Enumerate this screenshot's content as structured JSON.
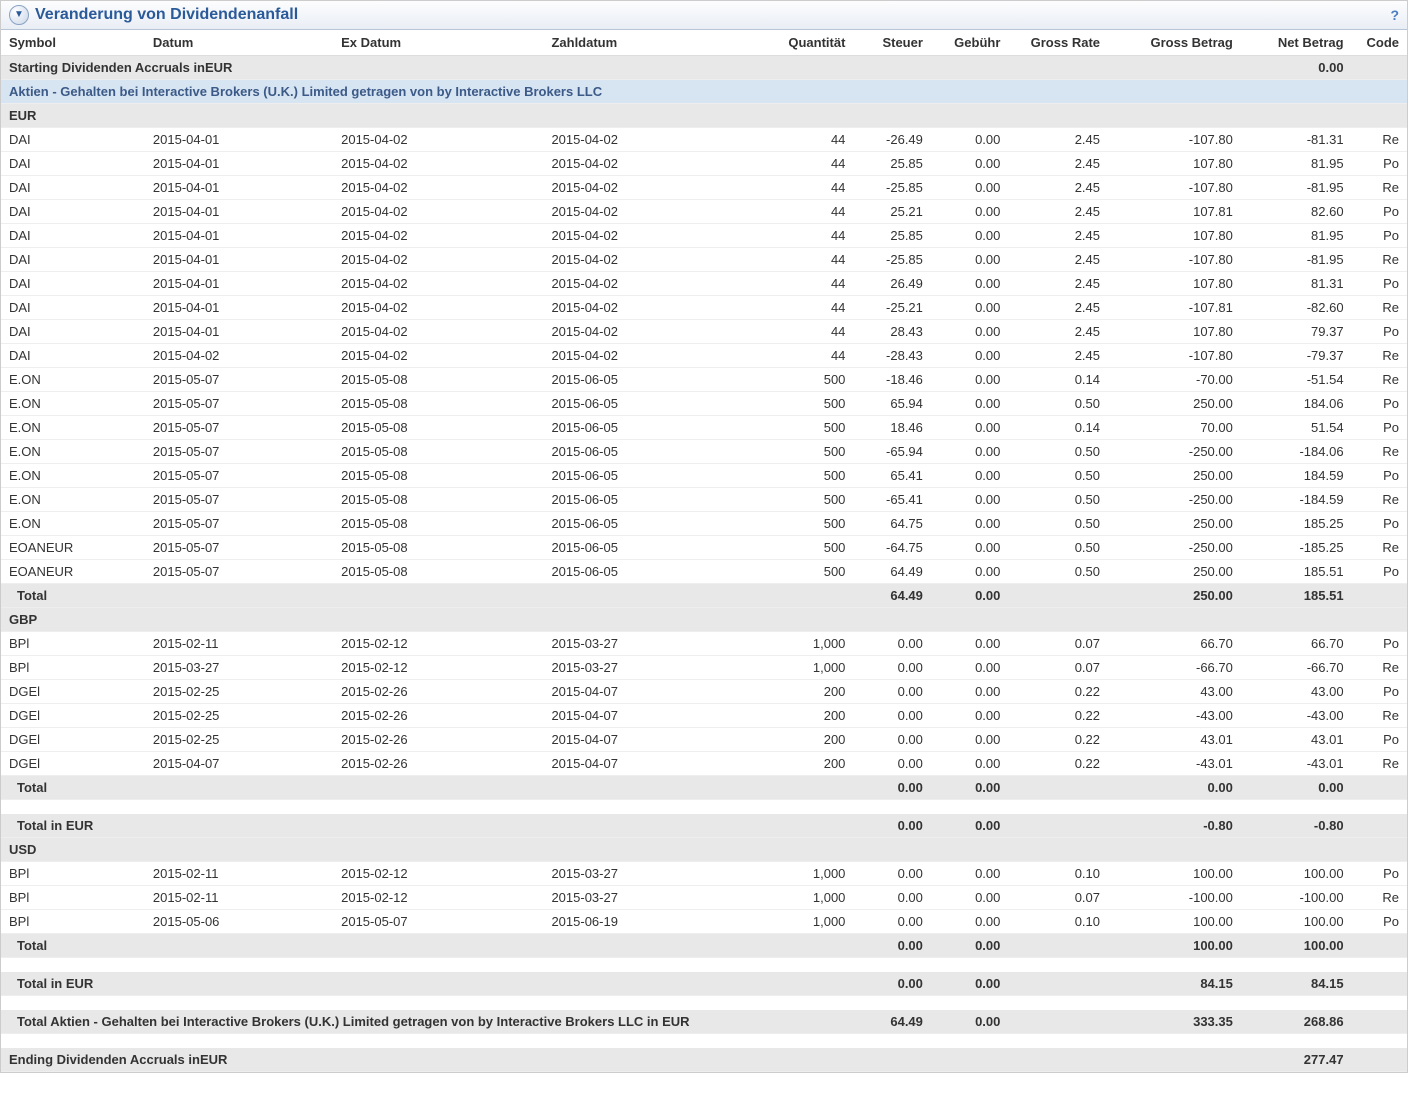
{
  "header": {
    "title": "Veranderung von Dividendenanfall"
  },
  "columns": {
    "symbol": "Symbol",
    "date": "Datum",
    "exdate": "Ex Datum",
    "paydate": "Zahldatum",
    "qty": "Quantität",
    "tax": "Steuer",
    "fee": "Gebühr",
    "grate": "Gross Rate",
    "gamt": "Gross Betrag",
    "namt": "Net Betrag",
    "code": "Code"
  },
  "labels": {
    "starting": "Starting Dividenden Accruals inEUR",
    "section": "Aktien - Gehalten bei Interactive Brokers (U.K.) Limited getragen von by Interactive Brokers LLC",
    "eur": "EUR",
    "gbp": "GBP",
    "usd": "USD",
    "total": "Total",
    "total_in_eur": "Total in EUR",
    "grand_total": "Total Aktien - Gehalten bei Interactive Brokers (U.K.) Limited getragen von by Interactive Brokers LLC in EUR",
    "ending": "Ending Dividenden Accruals inEUR"
  },
  "starting_net": "0.00",
  "ending_net": "277.47",
  "eur_rows": [
    {
      "sym": "DAI",
      "d": "2015-04-01",
      "ex": "2015-04-02",
      "pd": "2015-04-02",
      "q": "44",
      "tax": "-26.49",
      "fee": "0.00",
      "gr": "2.45",
      "ga": "-107.80",
      "na": "-81.31",
      "cd": "Re"
    },
    {
      "sym": "DAI",
      "d": "2015-04-01",
      "ex": "2015-04-02",
      "pd": "2015-04-02",
      "q": "44",
      "tax": "25.85",
      "fee": "0.00",
      "gr": "2.45",
      "ga": "107.80",
      "na": "81.95",
      "cd": "Po"
    },
    {
      "sym": "DAI",
      "d": "2015-04-01",
      "ex": "2015-04-02",
      "pd": "2015-04-02",
      "q": "44",
      "tax": "-25.85",
      "fee": "0.00",
      "gr": "2.45",
      "ga": "-107.80",
      "na": "-81.95",
      "cd": "Re"
    },
    {
      "sym": "DAI",
      "d": "2015-04-01",
      "ex": "2015-04-02",
      "pd": "2015-04-02",
      "q": "44",
      "tax": "25.21",
      "fee": "0.00",
      "gr": "2.45",
      "ga": "107.81",
      "na": "82.60",
      "cd": "Po"
    },
    {
      "sym": "DAI",
      "d": "2015-04-01",
      "ex": "2015-04-02",
      "pd": "2015-04-02",
      "q": "44",
      "tax": "25.85",
      "fee": "0.00",
      "gr": "2.45",
      "ga": "107.80",
      "na": "81.95",
      "cd": "Po"
    },
    {
      "sym": "DAI",
      "d": "2015-04-01",
      "ex": "2015-04-02",
      "pd": "2015-04-02",
      "q": "44",
      "tax": "-25.85",
      "fee": "0.00",
      "gr": "2.45",
      "ga": "-107.80",
      "na": "-81.95",
      "cd": "Re"
    },
    {
      "sym": "DAI",
      "d": "2015-04-01",
      "ex": "2015-04-02",
      "pd": "2015-04-02",
      "q": "44",
      "tax": "26.49",
      "fee": "0.00",
      "gr": "2.45",
      "ga": "107.80",
      "na": "81.31",
      "cd": "Po"
    },
    {
      "sym": "DAI",
      "d": "2015-04-01",
      "ex": "2015-04-02",
      "pd": "2015-04-02",
      "q": "44",
      "tax": "-25.21",
      "fee": "0.00",
      "gr": "2.45",
      "ga": "-107.81",
      "na": "-82.60",
      "cd": "Re"
    },
    {
      "sym": "DAI",
      "d": "2015-04-01",
      "ex": "2015-04-02",
      "pd": "2015-04-02",
      "q": "44",
      "tax": "28.43",
      "fee": "0.00",
      "gr": "2.45",
      "ga": "107.80",
      "na": "79.37",
      "cd": "Po"
    },
    {
      "sym": "DAI",
      "d": "2015-04-02",
      "ex": "2015-04-02",
      "pd": "2015-04-02",
      "q": "44",
      "tax": "-28.43",
      "fee": "0.00",
      "gr": "2.45",
      "ga": "-107.80",
      "na": "-79.37",
      "cd": "Re"
    },
    {
      "sym": "E.ON",
      "d": "2015-05-07",
      "ex": "2015-05-08",
      "pd": "2015-06-05",
      "q": "500",
      "tax": "-18.46",
      "fee": "0.00",
      "gr": "0.14",
      "ga": "-70.00",
      "na": "-51.54",
      "cd": "Re"
    },
    {
      "sym": "E.ON",
      "d": "2015-05-07",
      "ex": "2015-05-08",
      "pd": "2015-06-05",
      "q": "500",
      "tax": "65.94",
      "fee": "0.00",
      "gr": "0.50",
      "ga": "250.00",
      "na": "184.06",
      "cd": "Po"
    },
    {
      "sym": "E.ON",
      "d": "2015-05-07",
      "ex": "2015-05-08",
      "pd": "2015-06-05",
      "q": "500",
      "tax": "18.46",
      "fee": "0.00",
      "gr": "0.14",
      "ga": "70.00",
      "na": "51.54",
      "cd": "Po"
    },
    {
      "sym": "E.ON",
      "d": "2015-05-07",
      "ex": "2015-05-08",
      "pd": "2015-06-05",
      "q": "500",
      "tax": "-65.94",
      "fee": "0.00",
      "gr": "0.50",
      "ga": "-250.00",
      "na": "-184.06",
      "cd": "Re"
    },
    {
      "sym": "E.ON",
      "d": "2015-05-07",
      "ex": "2015-05-08",
      "pd": "2015-06-05",
      "q": "500",
      "tax": "65.41",
      "fee": "0.00",
      "gr": "0.50",
      "ga": "250.00",
      "na": "184.59",
      "cd": "Po"
    },
    {
      "sym": "E.ON",
      "d": "2015-05-07",
      "ex": "2015-05-08",
      "pd": "2015-06-05",
      "q": "500",
      "tax": "-65.41",
      "fee": "0.00",
      "gr": "0.50",
      "ga": "-250.00",
      "na": "-184.59",
      "cd": "Re"
    },
    {
      "sym": "E.ON",
      "d": "2015-05-07",
      "ex": "2015-05-08",
      "pd": "2015-06-05",
      "q": "500",
      "tax": "64.75",
      "fee": "0.00",
      "gr": "0.50",
      "ga": "250.00",
      "na": "185.25",
      "cd": "Po"
    },
    {
      "sym": "EOANEUR",
      "d": "2015-05-07",
      "ex": "2015-05-08",
      "pd": "2015-06-05",
      "q": "500",
      "tax": "-64.75",
      "fee": "0.00",
      "gr": "0.50",
      "ga": "-250.00",
      "na": "-185.25",
      "cd": "Re"
    },
    {
      "sym": "EOANEUR",
      "d": "2015-05-07",
      "ex": "2015-05-08",
      "pd": "2015-06-05",
      "q": "500",
      "tax": "64.49",
      "fee": "0.00",
      "gr": "0.50",
      "ga": "250.00",
      "na": "185.51",
      "cd": "Po"
    }
  ],
  "eur_total": {
    "tax": "64.49",
    "fee": "0.00",
    "ga": "250.00",
    "na": "185.51"
  },
  "gbp_rows": [
    {
      "sym": "BPl",
      "d": "2015-02-11",
      "ex": "2015-02-12",
      "pd": "2015-03-27",
      "q": "1,000",
      "tax": "0.00",
      "fee": "0.00",
      "gr": "0.07",
      "ga": "66.70",
      "na": "66.70",
      "cd": "Po"
    },
    {
      "sym": "BPl",
      "d": "2015-03-27",
      "ex": "2015-02-12",
      "pd": "2015-03-27",
      "q": "1,000",
      "tax": "0.00",
      "fee": "0.00",
      "gr": "0.07",
      "ga": "-66.70",
      "na": "-66.70",
      "cd": "Re"
    },
    {
      "sym": "DGEl",
      "d": "2015-02-25",
      "ex": "2015-02-26",
      "pd": "2015-04-07",
      "q": "200",
      "tax": "0.00",
      "fee": "0.00",
      "gr": "0.22",
      "ga": "43.00",
      "na": "43.00",
      "cd": "Po"
    },
    {
      "sym": "DGEl",
      "d": "2015-02-25",
      "ex": "2015-02-26",
      "pd": "2015-04-07",
      "q": "200",
      "tax": "0.00",
      "fee": "0.00",
      "gr": "0.22",
      "ga": "-43.00",
      "na": "-43.00",
      "cd": "Re"
    },
    {
      "sym": "DGEl",
      "d": "2015-02-25",
      "ex": "2015-02-26",
      "pd": "2015-04-07",
      "q": "200",
      "tax": "0.00",
      "fee": "0.00",
      "gr": "0.22",
      "ga": "43.01",
      "na": "43.01",
      "cd": "Po"
    },
    {
      "sym": "DGEl",
      "d": "2015-04-07",
      "ex": "2015-02-26",
      "pd": "2015-04-07",
      "q": "200",
      "tax": "0.00",
      "fee": "0.00",
      "gr": "0.22",
      "ga": "-43.01",
      "na": "-43.01",
      "cd": "Re"
    }
  ],
  "gbp_total": {
    "tax": "0.00",
    "fee": "0.00",
    "ga": "0.00",
    "na": "0.00"
  },
  "gbp_total_eur": {
    "tax": "0.00",
    "fee": "0.00",
    "ga": "-0.80",
    "na": "-0.80"
  },
  "usd_rows": [
    {
      "sym": "BPl",
      "d": "2015-02-11",
      "ex": "2015-02-12",
      "pd": "2015-03-27",
      "q": "1,000",
      "tax": "0.00",
      "fee": "0.00",
      "gr": "0.10",
      "ga": "100.00",
      "na": "100.00",
      "cd": "Po"
    },
    {
      "sym": "BPl",
      "d": "2015-02-11",
      "ex": "2015-02-12",
      "pd": "2015-03-27",
      "q": "1,000",
      "tax": "0.00",
      "fee": "0.00",
      "gr": "0.07",
      "ga": "-100.00",
      "na": "-100.00",
      "cd": "Re"
    },
    {
      "sym": "BPl",
      "d": "2015-05-06",
      "ex": "2015-05-07",
      "pd": "2015-06-19",
      "q": "1,000",
      "tax": "0.00",
      "fee": "0.00",
      "gr": "0.10",
      "ga": "100.00",
      "na": "100.00",
      "cd": "Po"
    }
  ],
  "usd_total": {
    "tax": "0.00",
    "fee": "0.00",
    "ga": "100.00",
    "na": "100.00"
  },
  "usd_total_eur": {
    "tax": "0.00",
    "fee": "0.00",
    "ga": "84.15",
    "na": "84.15"
  },
  "grand_total": {
    "tax": "64.49",
    "fee": "0.00",
    "ga": "333.35",
    "na": "268.86"
  }
}
